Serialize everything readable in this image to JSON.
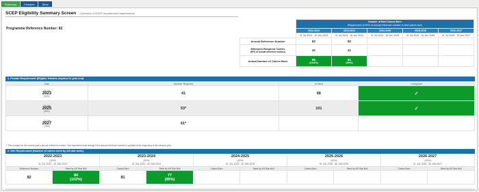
{
  "tabs": [
    {
      "label": "Summary",
      "active": true
    },
    {
      "label": "Females",
      "active": false
    },
    {
      "label": "Sires",
      "active": false
    }
  ],
  "page": {
    "title": "SCEP Eligibility Summary Screen",
    "subtitle": "- Overview of SCEP requirement requirements",
    "programme_ref_label": "Programme Reference Number: 82"
  },
  "summary": {
    "header_title": "Number of Beef Calves Born",
    "header_sub": "Requirement of 50% of annual reference number in beef calves born",
    "years": [
      {
        "year": "2022-2023",
        "dates": "01 Jul 2022 - 30 Jun 2023"
      },
      {
        "year": "2023-2024",
        "dates": "01 Jul 2023 - 30 Jun 2024"
      },
      {
        "year": "2024-2025",
        "dates": "01 Jul 2024 - 30 Jun 2025"
      },
      {
        "year": "2025-2026",
        "dates": "01 Jul 2025 - 30 Jun 2026"
      },
      {
        "year": "2026-2027",
        "dates": "01 Jul 2026 - 30 Jun 2027"
      }
    ],
    "row_annual_label": "Annual Reference Number",
    "annual_values": [
      "82",
      "82",
      "",
      "",
      ""
    ],
    "row_min_label": "Minimum Required Calves",
    "row_min_sub": "(50% of annual reference number)",
    "min_values": [
      "41",
      "41",
      "",
      "",
      ""
    ],
    "row_actual_label": "Actual Number of Calves Born",
    "actual_values": [
      {
        "num": "85",
        "pct": "(104%)"
      },
      {
        "num": "81",
        "pct": "(99%)"
      },
      {
        "num": "",
        "pct": ""
      },
      {
        "num": "",
        "pct": ""
      },
      {
        "num": "",
        "pct": ""
      }
    ]
  },
  "section1": {
    "header": "1. Female Requirement (Eligible females required in year-end)",
    "columns": [
      "Date",
      "Number Required",
      "In Herd",
      "Compliant"
    ],
    "rows": [
      {
        "date_pre": "31-Oct",
        "year": "2023",
        "pct": "(50%)",
        "required": "41",
        "in_herd": "68",
        "compliant": "✓"
      },
      {
        "date_pre": "31-Oct",
        "year": "2025",
        "pct": "(65%)",
        "required": "53*",
        "in_herd": "101",
        "compliant": "✓"
      },
      {
        "date_pre": "31-Oct",
        "year": "2027",
        "pct": "(75%)",
        "required": "61*",
        "in_herd": "",
        "compliant": ""
      }
    ],
    "note": "* This is based on the current year's annual reference number. This requirement will change if the annual reference number is updated at the beginning of the relevant year."
  },
  "section2": {
    "header": "2. Sire Requirement (Number of calves sired by 4/5-star bulls)",
    "years": [
      {
        "year": "2022-2023",
        "pct": "(20%)",
        "dates": "01 JUL 2022 - 30 JUN 2023"
      },
      {
        "year": "2023-2024",
        "pct": "(20%)",
        "dates": "01 JUL 2023 - 30 JUN 2024"
      },
      {
        "year": "2024-2025",
        "pct": "(20%)",
        "dates": "01 JUL 2024 - 30 JUN 2025"
      },
      {
        "year": "2025-2026",
        "pct": "(20%)",
        "dates": "01 JUL 2025 - 30 JUN 2026"
      },
      {
        "year": "2026-2027",
        "pct": "(20%)",
        "dates": "01 JUL 2026 - 30 JUN 2027"
      }
    ],
    "sub_cols": [
      [
        "Reference Number",
        "Sired by 4/5 Star Bull"
      ],
      [
        "Calves Born",
        "Sired by 4/5 Star Bull"
      ],
      [
        "Calves Born",
        "Sired by 4/5 Star Bull"
      ],
      [
        "Calves Born",
        "Sired by 4/5 Star Bull"
      ],
      [
        "Calves Born",
        "Sired by 4/5 Star Bull"
      ]
    ],
    "values": [
      {
        "left": "82",
        "right_num": "84",
        "right_pct": "(102%)"
      },
      {
        "left": "81",
        "right_num": "77",
        "right_pct": "(95%)"
      },
      {
        "left": "",
        "right_num": "",
        "right_pct": ""
      },
      {
        "left": "",
        "right_num": "",
        "right_pct": ""
      },
      {
        "left": "",
        "right_num": "",
        "right_pct": ""
      }
    ]
  },
  "colors": {
    "primary": "#1f6fa8",
    "success": "#0d9a2b",
    "tab_active": "#3aa64a"
  }
}
